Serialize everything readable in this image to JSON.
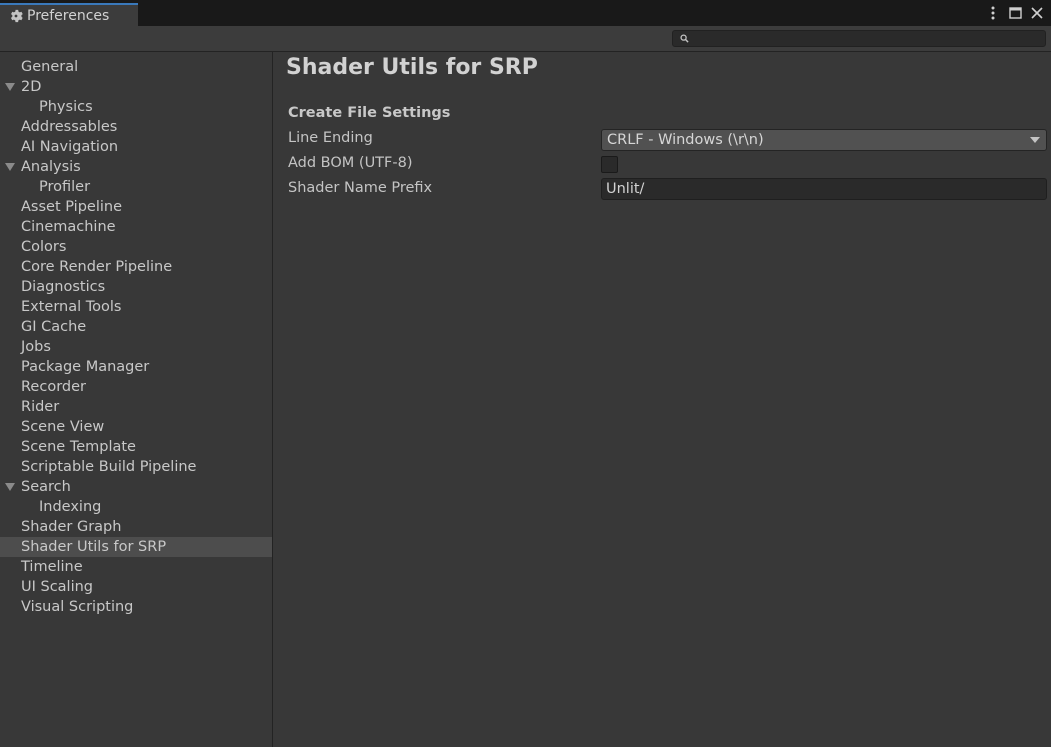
{
  "window": {
    "tab_title": "Preferences",
    "tab_icon": "gear-icon",
    "controls": [
      "more-options-icon",
      "maximize-icon",
      "close-icon"
    ]
  },
  "toolbar": {
    "search_placeholder": "",
    "search_value": ""
  },
  "sidebar": {
    "items": [
      {
        "label": "General",
        "level": 0
      },
      {
        "label": "2D",
        "level": 0,
        "expanded": true
      },
      {
        "label": "Physics",
        "level": 1
      },
      {
        "label": "Addressables",
        "level": 0
      },
      {
        "label": "AI Navigation",
        "level": 0
      },
      {
        "label": "Analysis",
        "level": 0,
        "expanded": true
      },
      {
        "label": "Profiler",
        "level": 1
      },
      {
        "label": "Asset Pipeline",
        "level": 0
      },
      {
        "label": "Cinemachine",
        "level": 0
      },
      {
        "label": "Colors",
        "level": 0
      },
      {
        "label": "Core Render Pipeline",
        "level": 0
      },
      {
        "label": "Diagnostics",
        "level": 0
      },
      {
        "label": "External Tools",
        "level": 0
      },
      {
        "label": "GI Cache",
        "level": 0
      },
      {
        "label": "Jobs",
        "level": 0
      },
      {
        "label": "Package Manager",
        "level": 0
      },
      {
        "label": "Recorder",
        "level": 0
      },
      {
        "label": "Rider",
        "level": 0
      },
      {
        "label": "Scene View",
        "level": 0
      },
      {
        "label": "Scene Template",
        "level": 0
      },
      {
        "label": "Scriptable Build Pipeline",
        "level": 0
      },
      {
        "label": "Search",
        "level": 0,
        "expanded": true
      },
      {
        "label": "Indexing",
        "level": 1
      },
      {
        "label": "Shader Graph",
        "level": 0
      },
      {
        "label": "Shader Utils for SRP",
        "level": 0,
        "selected": true
      },
      {
        "label": "Timeline",
        "level": 0
      },
      {
        "label": "UI Scaling",
        "level": 0
      },
      {
        "label": "Visual Scripting",
        "level": 0
      }
    ]
  },
  "main": {
    "title": "Shader Utils for SRP",
    "section_title": "Create File Settings",
    "line_ending": {
      "label": "Line Ending",
      "value": "CRLF - Windows (\\r\\n)"
    },
    "add_bom": {
      "label": "Add BOM (UTF-8)",
      "checked": false
    },
    "shader_name_prefix": {
      "label": "Shader Name Prefix",
      "value": "Unlit/"
    }
  },
  "colors": {
    "accent": "#3a79bb",
    "background": "#383838",
    "selected_row": "#4d4d4d"
  }
}
